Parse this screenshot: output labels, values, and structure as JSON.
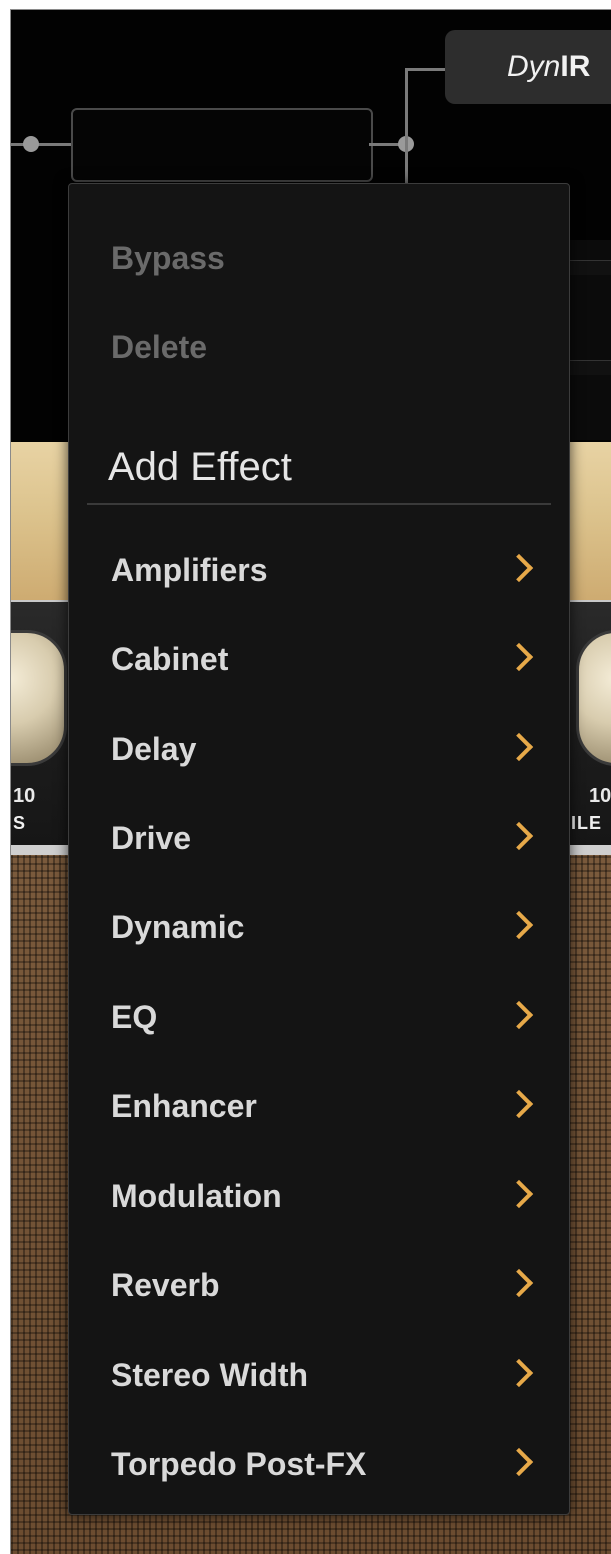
{
  "colors": {
    "menu_bg": "#141414",
    "chevron_accent": "#e7a949",
    "disabled_text": "#6a6a6a",
    "item_text": "#d9d9d9"
  },
  "chain": {
    "module_name_italic": "Dyn",
    "module_name_bold": "IR"
  },
  "amp": {
    "left_knob_value": "10",
    "left_knob_label": "S",
    "right_knob_value": "10",
    "right_knob_label": "ILE"
  },
  "menu": {
    "bypass": "Bypass",
    "delete": "Delete",
    "add_effect_header": "Add Effect",
    "categories": [
      {
        "label": "Amplifiers",
        "icon": "chevron-right-icon"
      },
      {
        "label": "Cabinet",
        "icon": "chevron-right-icon"
      },
      {
        "label": "Delay",
        "icon": "chevron-right-icon"
      },
      {
        "label": "Drive",
        "icon": "chevron-right-icon"
      },
      {
        "label": "Dynamic",
        "icon": "chevron-right-icon"
      },
      {
        "label": "EQ",
        "icon": "chevron-right-icon"
      },
      {
        "label": "Enhancer",
        "icon": "chevron-right-icon"
      },
      {
        "label": "Modulation",
        "icon": "chevron-right-icon"
      },
      {
        "label": "Reverb",
        "icon": "chevron-right-icon"
      },
      {
        "label": "Stereo Width",
        "icon": "chevron-right-icon"
      },
      {
        "label": "Torpedo Post-FX",
        "icon": "chevron-right-icon"
      }
    ]
  }
}
